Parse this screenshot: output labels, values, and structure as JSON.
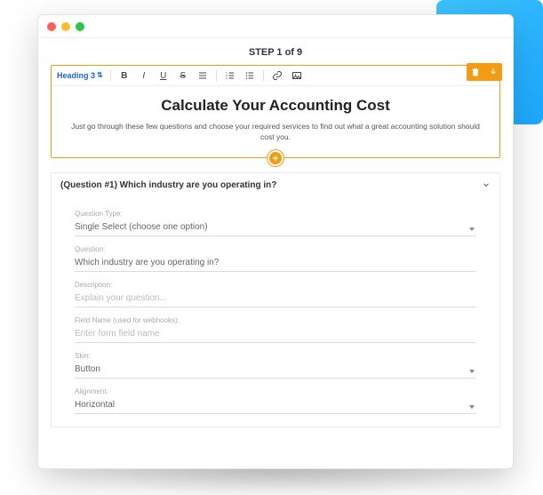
{
  "step_label": "STEP 1 of 9",
  "toolbar": {
    "heading_label": "Heading 3"
  },
  "editor": {
    "title": "Calculate Your Accounting Cost",
    "subtitle": "Just go through these few questions and choose your required services to find out what a great accounting solution should cost you."
  },
  "question": {
    "header": "(Question #1) Which industry are you operating in?",
    "fields": {
      "type": {
        "label": "Question Type:",
        "value": "Single Select (choose one option)"
      },
      "question": {
        "label": "Question:",
        "value": "Which industry are you operating in?"
      },
      "description": {
        "label": "Description:",
        "placeholder": "Explain your question..."
      },
      "fieldname": {
        "label": "Field Name (used for webhooks):",
        "placeholder": "Enter form field name"
      },
      "skin": {
        "label": "Skin:",
        "value": "Button"
      },
      "alignment": {
        "label": "Alignment:",
        "value": "Horizontal"
      }
    }
  }
}
